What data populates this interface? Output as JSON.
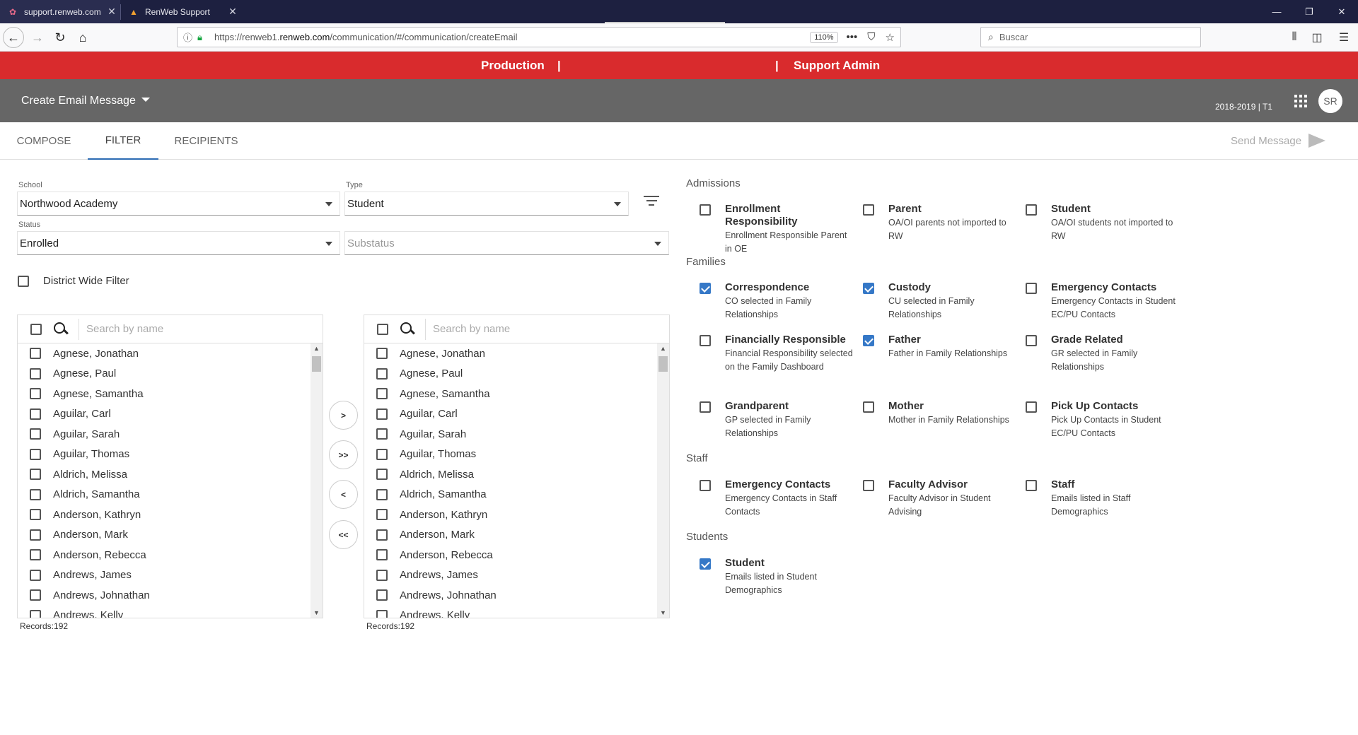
{
  "browser": {
    "tabs": [
      {
        "title": "support.renweb.com",
        "favicon": "renweb-favicon-icon",
        "active": true
      },
      {
        "title": "RenWeb Support",
        "favicon": "renweb-support-icon",
        "active": false
      }
    ],
    "url_prefix": "https://renweb1.",
    "url_domain": "renweb.com",
    "url_path": "/communication/#/communication/createEmail",
    "zoom": "110%",
    "search_placeholder": "Buscar"
  },
  "banner": {
    "left": "Production",
    "sep1": "|",
    "sep2": "|",
    "right": "Support Admin"
  },
  "header": {
    "title": "Create Email Message",
    "term": "2018-2019 | T1",
    "avatar": "SR"
  },
  "tabs": {
    "compose": "COMPOSE",
    "filter": "FILTER",
    "recipients": "RECIPIENTS",
    "active": "FILTER",
    "send": "Send Message"
  },
  "filters": {
    "school_label": "School",
    "school_value": "Northwood Academy",
    "type_label": "Type",
    "type_value": "Student",
    "status_label": "Status",
    "status_value": "Enrolled",
    "substatus_placeholder": "Substatus",
    "district_wide": "District Wide Filter"
  },
  "lists": {
    "search_placeholder": "Search by name",
    "left_records": "Records:192",
    "right_records": "Records:192",
    "names": [
      "Agnese, Jonathan",
      "Agnese, Paul",
      "Agnese, Samantha",
      "Aguilar, Carl",
      "Aguilar, Sarah",
      "Aguilar, Thomas",
      "Aldrich, Melissa",
      "Aldrich, Samantha",
      "Anderson, Kathryn",
      "Anderson, Mark",
      "Anderson, Rebecca",
      "Andrews, James",
      "Andrews, Johnathan",
      "Andrews, Kelly"
    ]
  },
  "move_buttons": {
    "add": ">",
    "add_all": ">>",
    "remove": "<",
    "remove_all": "<<"
  },
  "groups": {
    "admissions": {
      "title": "Admissions",
      "items": [
        {
          "label": "Enrollment Responsibility",
          "desc": "Enrollment Responsible Parent in OE",
          "checked": false
        },
        {
          "label": "Parent",
          "desc": "OA/OI parents not imported to RW",
          "checked": false
        },
        {
          "label": "Student",
          "desc": "OA/OI students not imported to RW",
          "checked": false
        }
      ]
    },
    "families": {
      "title": "Families",
      "items": [
        {
          "label": "Correspondence",
          "desc": "CO selected in Family Relationships",
          "checked": true
        },
        {
          "label": "Custody",
          "desc": "CU selected in Family Relationships",
          "checked": true
        },
        {
          "label": "Emergency Contacts",
          "desc": "Emergency Contacts in Student EC/PU Contacts",
          "checked": false
        },
        {
          "label": "Financially Responsible",
          "desc": "Financial Responsibility selected on the Family Dashboard",
          "checked": false
        },
        {
          "label": "Father",
          "desc": "Father in Family Relationships",
          "checked": true
        },
        {
          "label": "Grade Related",
          "desc": "GR selected in Family Relationships",
          "checked": false
        },
        {
          "label": "Grandparent",
          "desc": "GP selected in Family Relationships",
          "checked": false
        },
        {
          "label": "Mother",
          "desc": "Mother in Family Relationships",
          "checked": false
        },
        {
          "label": "Pick Up Contacts",
          "desc": "Pick Up Contacts in Student EC/PU Contacts",
          "checked": false
        }
      ]
    },
    "staff": {
      "title": "Staff",
      "items": [
        {
          "label": "Emergency Contacts",
          "desc": "Emergency Contacts in Staff Contacts",
          "checked": false
        },
        {
          "label": "Faculty Advisor",
          "desc": "Faculty Advisor in Student Advising",
          "checked": false
        },
        {
          "label": "Staff",
          "desc": "Emails listed in Staff Demographics",
          "checked": false
        }
      ]
    },
    "students": {
      "title": "Students",
      "items": [
        {
          "label": "Student",
          "desc": "Emails listed in Student Demographics",
          "checked": true
        }
      ]
    }
  },
  "colors": {
    "banner": "#d92b2d",
    "header": "#666666",
    "accent": "#3578c7",
    "tabbar": "#1d2040"
  }
}
